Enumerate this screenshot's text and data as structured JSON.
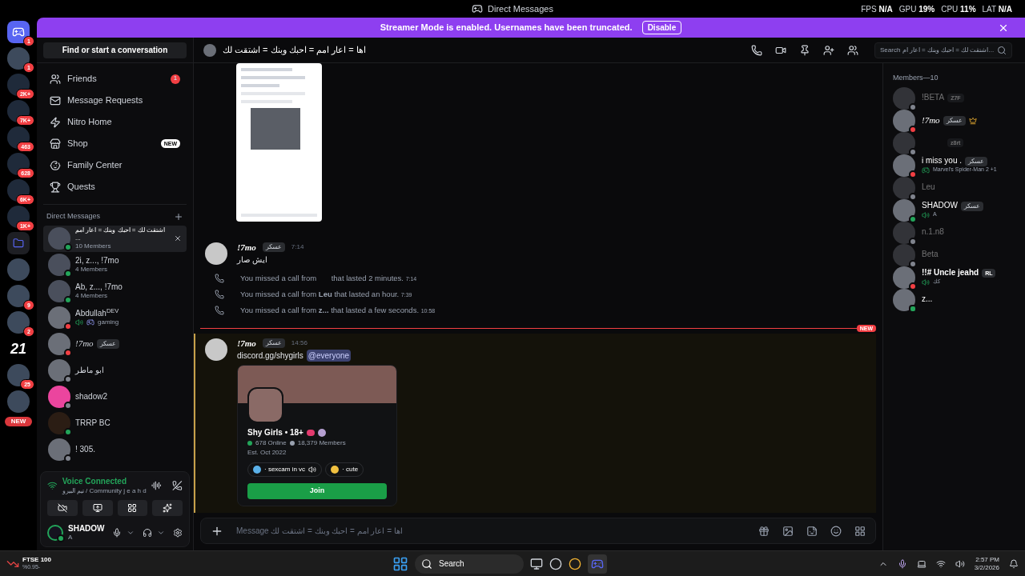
{
  "titlebar": {
    "title": "Direct Messages",
    "stats": [
      {
        "label": "FPS",
        "value": "N/A"
      },
      {
        "label": "GPU",
        "value": "19%"
      },
      {
        "label": "CPU",
        "value": "11%"
      },
      {
        "label": "LAT",
        "value": "N/A"
      }
    ]
  },
  "banner": {
    "text": "Streamer Mode is enabled. Usernames have been truncated.",
    "button": "Disable"
  },
  "servers": [
    {
      "kind": "home",
      "badge": "1",
      "selected": true
    },
    {
      "kind": "avatar",
      "badge": "1",
      "selected": false
    },
    {
      "kind": "group",
      "badge": "2K+",
      "selected": false
    },
    {
      "kind": "group",
      "badge": "7K+",
      "selected": false
    },
    {
      "kind": "group",
      "badge": "463",
      "selected": false
    },
    {
      "kind": "group",
      "badge": "628",
      "selected": false
    },
    {
      "kind": "group",
      "badge": "6K+",
      "selected": false
    },
    {
      "kind": "group",
      "badge": "1K+",
      "selected": false
    },
    {
      "kind": "folder",
      "selected": false
    },
    {
      "kind": "avatar",
      "selected": false
    },
    {
      "kind": "avatar",
      "badge": "9",
      "selected": false
    },
    {
      "kind": "avatar",
      "badge": "2",
      "selected": false
    },
    {
      "kind": "text",
      "label": "21",
      "selected": false
    },
    {
      "kind": "avatar",
      "badge": "25",
      "selected": false
    },
    {
      "kind": "avatar",
      "selected": false
    }
  ],
  "new_pill": "NEW",
  "sidebar": {
    "search": "Find or start a conversation",
    "nav": [
      {
        "kind": "friends",
        "label": "Friends",
        "count": "1",
        "selected": false
      },
      {
        "kind": "mail",
        "label": "Message Requests",
        "selected": false
      },
      {
        "kind": "nitro",
        "label": "Nitro Home",
        "selected": false
      },
      {
        "kind": "shop",
        "label": "Shop",
        "tag": "NEW",
        "selected": false
      },
      {
        "kind": "family",
        "label": "Family Center",
        "selected": false
      },
      {
        "kind": "quests",
        "label": "Quests",
        "selected": false
      }
    ],
    "dm_header": "Direct Messages",
    "dms": [
      {
        "kind": "group",
        "name": "اشتقت لك = احبك وبنك = اعار امم ...",
        "sub": "10 Members",
        "color": "#23a55a",
        "selected": true
      },
      {
        "kind": "group",
        "name": "2i, z..., !7mo",
        "sub": "4 Members",
        "color": "#23a55a",
        "selected": false
      },
      {
        "kind": "group",
        "name": "Ab, z..., !7mo",
        "sub": "4 Members",
        "color": "#23a55a",
        "selected": false
      },
      {
        "kind": "photo",
        "name": "Abdullah$^{DEV}$",
        "sub": "gaming",
        "voice": true,
        "color": "#f23f43",
        "selected": false
      },
      {
        "kind": "photo",
        "name": "!7mo",
        "tag": "عسكر",
        "color": "#f23f43",
        "selected": false
      },
      {
        "kind": "photo",
        "name": "ابو ماطر",
        "color": "#80848e",
        "selected": false
      },
      {
        "kind": "discord",
        "name": "shadow2",
        "color": "#80848e",
        "selected": false
      },
      {
        "kind": "logo",
        "name": "TRRP BC",
        "color": "#23a55a",
        "selected": false
      },
      {
        "kind": "photo",
        "name": "! 305.",
        "color": "#80848e",
        "selected": false
      }
    ]
  },
  "voice": {
    "title": "Voice Connected",
    "channel": "تيم البيرو / Community j e a h d"
  },
  "user": {
    "name": "SHADOW",
    "status_text": "A",
    "color": "#23a55a"
  },
  "header": {
    "title": "اها = اعار امم = احبك وبنك = اشتقت لك",
    "search": "Search اشتقت لك = احبك وبنك = اعار ام..."
  },
  "messages": [
    {
      "kind": "image"
    },
    {
      "kind": "message",
      "author": "!7mo",
      "tag": "عسكر",
      "time": "7:14",
      "text": "ايش صار"
    },
    {
      "kind": "call",
      "text": "You missed a call from       that lasted 2 minutes.",
      "time": "7:14"
    },
    {
      "kind": "call",
      "text": "You missed a call from **Leu** that lasted an hour.",
      "time": "7:39"
    },
    {
      "kind": "call",
      "text": "You missed a call from **z...** that lasted a few seconds.",
      "time": "10:58"
    },
    {
      "kind": "divider",
      "label": "NEW"
    },
    {
      "kind": "message",
      "author": "!7mo",
      "tag": "عسكر",
      "time": "14:56",
      "text": "discord.gg/shygirls",
      "ping": "@everyone",
      "mention": true,
      "invite": {
        "name": "Shy Girls • 18+",
        "online": "678 Online",
        "members": "18,379 Members",
        "est": "Est. Oct 2022",
        "tags": [
          {
            "kind": "drops",
            "label": "· sexcam in vc",
            "voice": true
          },
          {
            "kind": "smile",
            "label": "· cute",
            "voice": false
          }
        ],
        "button": "Join"
      }
    }
  ],
  "composer": {
    "placeholder": "Message اها = اعار امم = احبك وبنك = اشتقت لك"
  },
  "members_header": "Members—10",
  "members": [
    {
      "name": "!BETA",
      "guild": "Z7F",
      "color": "#80848e",
      "mobile": false,
      "faded": true
    },
    {
      "name": "!7mo",
      "tag": "عسكر",
      "crown": true,
      "color": "#f23f43",
      "mobile": false,
      "faded": false
    },
    {
      "guild": "z8rt",
      "color": "#80848e",
      "mobile": false,
      "faded": true
    },
    {
      "name": "i miss you .",
      "tag": "عسكر",
      "activity": "Marvel's Spider-Man 2 +1",
      "color": "#f23f43",
      "mobile": false,
      "faded": false
    },
    {
      "name": "Leu",
      "color": "#80848e",
      "mobile": false,
      "faded": true
    },
    {
      "name": "SHADOW",
      "tag": "عسكر",
      "voice": "A",
      "color": "#23a55a",
      "mobile": false,
      "faded": false
    },
    {
      "name": "n.1.n8",
      "color": "#80848e",
      "mobile": false,
      "faded": true
    },
    {
      "name": "Beta",
      "color": "#80848e",
      "mobile": false,
      "faded": true
    },
    {
      "name": "!!# Uncle jeahd",
      "guild": "RL",
      "voice": "كك",
      "color": "#f23f43",
      "mobile": false,
      "faded": false
    },
    {
      "name": "z...",
      "color": "#23a55a",
      "mobile": true,
      "faded": false
    }
  ],
  "taskbar": {
    "stock": {
      "name": "FTSE 100",
      "change": "%0.95-"
    },
    "search": "Search",
    "time": "2:57 PM",
    "date": "3/2/2026"
  }
}
